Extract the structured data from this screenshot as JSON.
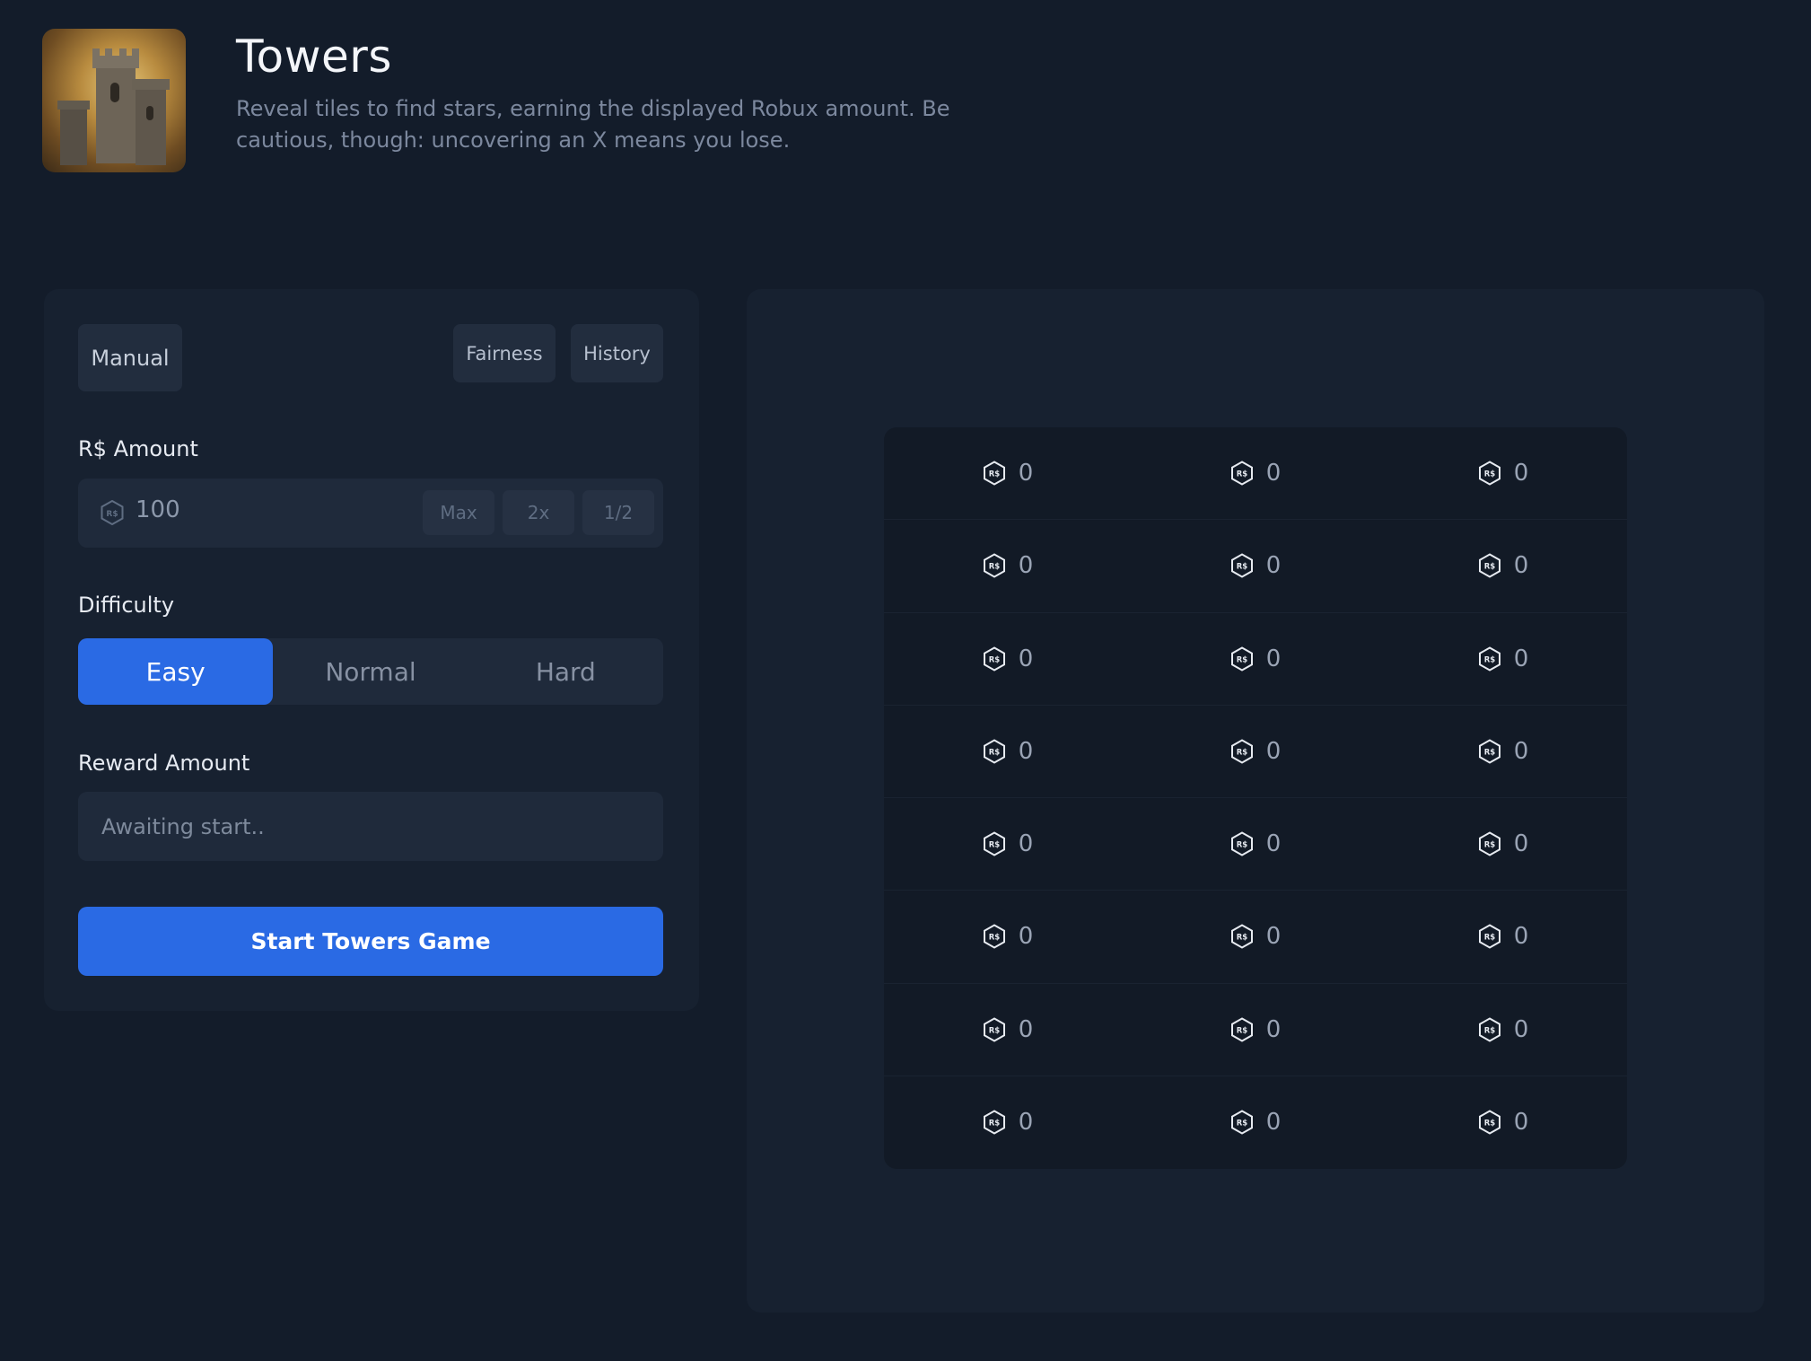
{
  "header": {
    "title": "Towers",
    "description": "Reveal tiles to find stars, earning the displayed Robux amount. Be cautious, though: uncovering an X means you lose.",
    "thumbnail": "towers-game-thumbnail"
  },
  "controls": {
    "mode_tab": "Manual",
    "fairness_label": "Fairness",
    "history_label": "History",
    "amount_label": "R$ Amount",
    "amount_value": "100",
    "max_label": "Max",
    "double_label": "2x",
    "half_label": "1/2",
    "difficulty_label": "Difficulty",
    "difficulty_options": [
      "Easy",
      "Normal",
      "Hard"
    ],
    "difficulty_selected": "Easy",
    "reward_label": "Reward Amount",
    "reward_placeholder": "Awaiting start..",
    "start_label": "Start Towers Game"
  },
  "board": {
    "currency_icon": "robux-icon",
    "rows": [
      [
        "0",
        "0",
        "0"
      ],
      [
        "0",
        "0",
        "0"
      ],
      [
        "0",
        "0",
        "0"
      ],
      [
        "0",
        "0",
        "0"
      ],
      [
        "0",
        "0",
        "0"
      ],
      [
        "0",
        "0",
        "0"
      ],
      [
        "0",
        "0",
        "0"
      ],
      [
        "0",
        "0",
        "0"
      ]
    ]
  },
  "colors": {
    "background": "#131c2a",
    "panel": "#172130",
    "accent": "#2a6ae4"
  }
}
